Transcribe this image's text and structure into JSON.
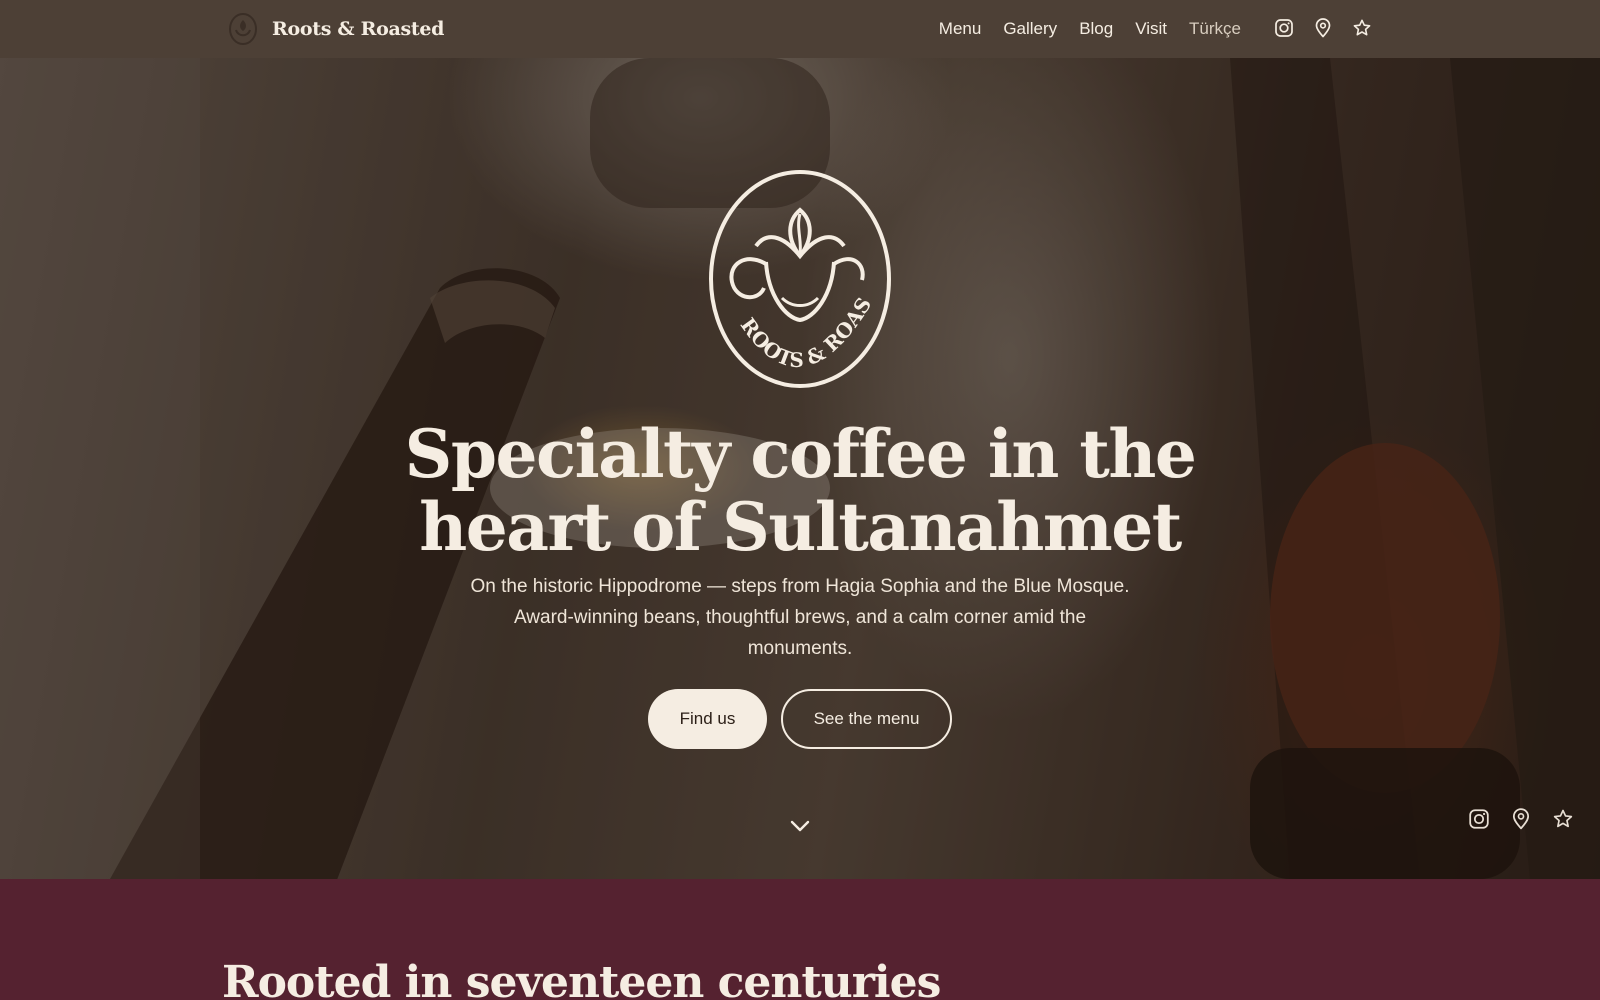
{
  "nav": {
    "brand": "Roots & Roasted",
    "links": [
      "Menu",
      "Gallery",
      "Blog",
      "Visit",
      "Türkçe"
    ],
    "icons": [
      "instagram-icon",
      "map-pin-icon",
      "star-icon"
    ]
  },
  "hero": {
    "logo_text": "ROOTS & ROASTED",
    "title": "Specialty coffee in the heart of Sultanahmet",
    "subtitle": "On the historic Hippodrome — steps from Hagia Sophia and the Blue Mosque. Award-winning beans, thoughtful brews, and a calm corner amid the monuments.",
    "primary_cta": "Find us",
    "secondary_cta": "See the menu",
    "social_icons": [
      "instagram-icon",
      "map-pin-icon",
      "star-icon"
    ]
  },
  "story": {
    "title": "Rooted in seventeen centuries"
  },
  "colors": {
    "nav_bg": "#4d4036",
    "cream": "#f5ede2",
    "section_bg": "#552230"
  }
}
